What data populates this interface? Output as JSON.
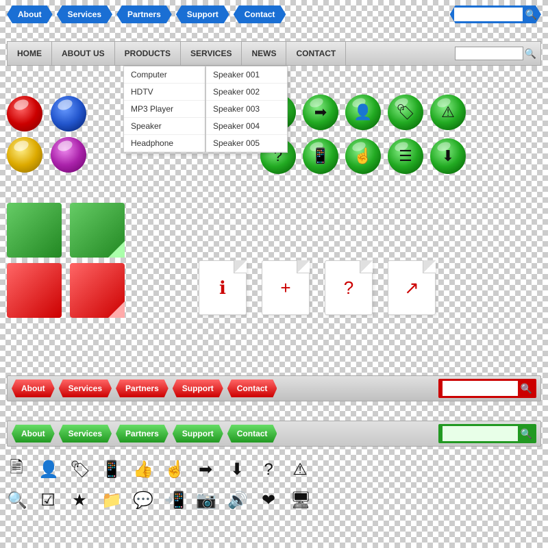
{
  "nav1": {
    "buttons": [
      "About",
      "Services",
      "Partners",
      "Support",
      "Contact"
    ],
    "search_placeholder": ""
  },
  "nav2": {
    "items": [
      "HOME",
      "ABOUT US",
      "PRODUCTS",
      "SERVICES",
      "NEWS",
      "CONTACT"
    ],
    "search_placeholder": ""
  },
  "dropdown": {
    "items": [
      "Computer",
      "HDTV",
      "MP3 Player",
      "Speaker",
      "Headphone"
    ],
    "sub_items": [
      "Speaker 001",
      "Speaker 002",
      "Speaker 003",
      "Speaker 004",
      "Speaker 005"
    ]
  },
  "nav3": {
    "buttons": [
      "About",
      "Services",
      "Partners",
      "Support",
      "Contact"
    ],
    "search_placeholder": ""
  },
  "nav4": {
    "buttons": [
      "About",
      "Services",
      "Partners",
      "Support",
      "Contact"
    ],
    "search_placeholder": ""
  },
  "icons_row1": [
    "🗎",
    "👤",
    "🏷",
    "📱",
    "👍",
    "☝",
    "➡",
    "⬇",
    "?",
    "⚠"
  ],
  "icons_row2": [
    "🔍",
    "☑",
    "★",
    "📁",
    "💬",
    "📱",
    "📷",
    "🔊",
    "❤",
    "🖥"
  ]
}
